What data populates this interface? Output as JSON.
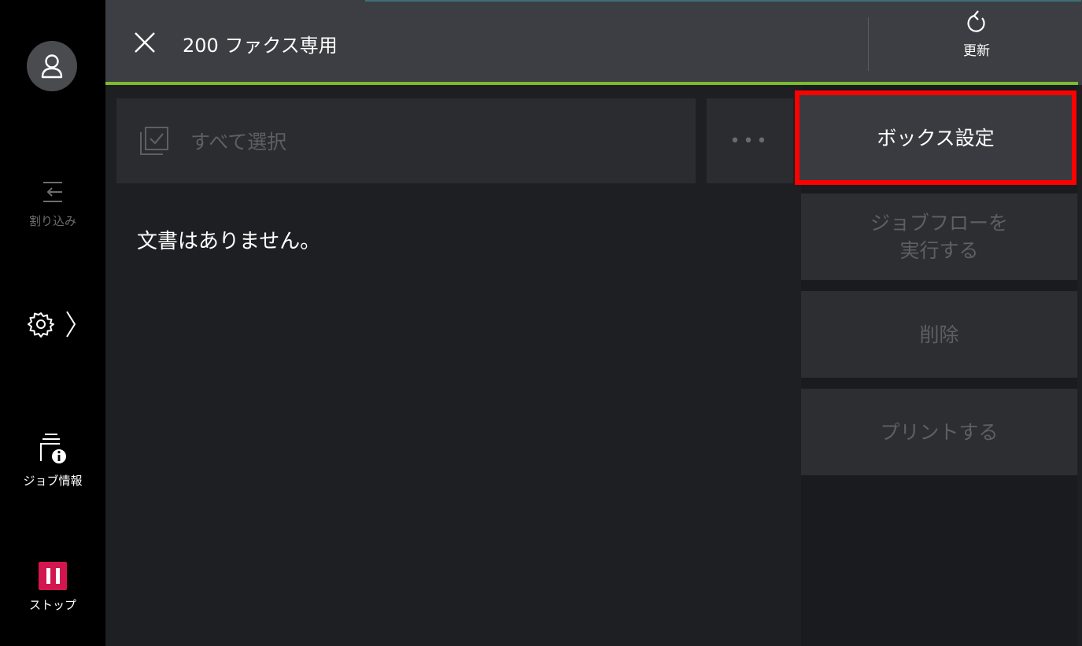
{
  "sidebar": {
    "avatar_icon": "user-icon",
    "interrupt": {
      "icon": "interrupt-icon",
      "label": "割り込み"
    },
    "settings": {
      "icon": "gear-icon"
    },
    "job_info": {
      "icon": "job-info-icon",
      "label": "ジョブ情報"
    },
    "stop": {
      "icon": "pause-icon",
      "label": "ストップ",
      "color": "#d3164f"
    }
  },
  "header": {
    "title": "200 ファクス専用",
    "refresh_label": "更新",
    "accent_color": "#7bbd2a"
  },
  "toolbar": {
    "select_all_label": "すべて選択",
    "more_label": "•••"
  },
  "main": {
    "empty_message": "文書はありません。"
  },
  "actions": {
    "box_settings": "ボックス設定",
    "run_jobflow_line1": "ジョブフローを",
    "run_jobflow_line2": "実行する",
    "delete": "削除",
    "print": "プリントする",
    "highlight_color": "#ff0000"
  }
}
